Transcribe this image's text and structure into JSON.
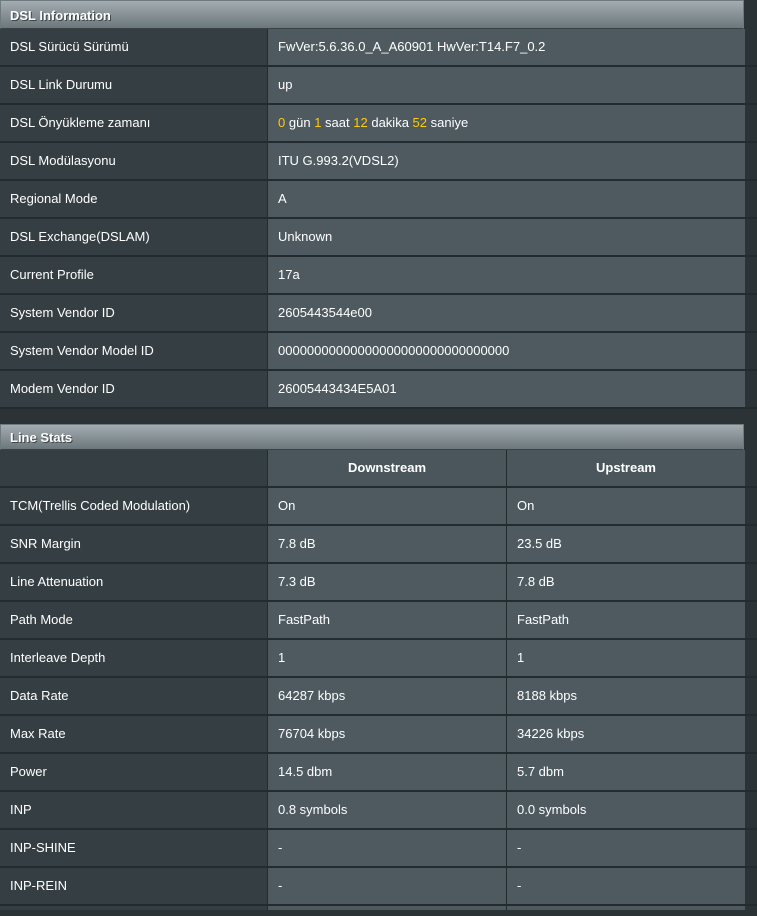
{
  "dsl_info": {
    "title": "DSL Information",
    "rows": [
      {
        "label": "DSL Sürücü Sürümü",
        "value": "FwVer:5.6.36.0_A_A60901 HwVer:T14.F7_0.2"
      },
      {
        "label": "DSL Link Durumu",
        "value": "up"
      },
      {
        "label": "DSL Modülasyonu",
        "value": "ITU G.993.2(VDSL2)"
      },
      {
        "label": "Regional Mode",
        "value": "A"
      },
      {
        "label": "DSL Exchange(DSLAM)",
        "value": "Unknown"
      },
      {
        "label": "Current Profile",
        "value": "17a"
      },
      {
        "label": "System Vendor ID",
        "value": "2605443544e00"
      },
      {
        "label": "System Vendor Model ID",
        "value": "00000000000000000000000000000000"
      },
      {
        "label": "Modem Vendor ID",
        "value": "26005443434E5A01"
      }
    ],
    "uptime": {
      "label": "DSL Önyükleme zamanı",
      "days": "0",
      "days_unit": "gün",
      "hours": "1",
      "hours_unit": "saat",
      "minutes": "12",
      "minutes_unit": "dakika",
      "seconds": "52",
      "seconds_unit": "saniye",
      "highlight_color": "#ffcc00"
    }
  },
  "line_stats": {
    "title": "Line Stats",
    "col_downstream": "Downstream",
    "col_upstream": "Upstream",
    "rows": [
      {
        "label": "TCM(Trellis Coded Modulation)",
        "down": "On",
        "up": "On"
      },
      {
        "label": "SNR Margin",
        "down": "7.8 dB",
        "up": "23.5 dB"
      },
      {
        "label": "Line Attenuation",
        "down": "7.3 dB",
        "up": "7.8 dB"
      },
      {
        "label": "Path Mode",
        "down": "FastPath",
        "up": "FastPath"
      },
      {
        "label": "Interleave Depth",
        "down": "1",
        "up": "1"
      },
      {
        "label": "Data Rate",
        "down": "64287 kbps",
        "up": "8188 kbps"
      },
      {
        "label": "Max Rate",
        "down": "76704 kbps",
        "up": "34226 kbps"
      },
      {
        "label": "Power",
        "down": "14.5 dbm",
        "up": "5.7 dbm"
      },
      {
        "label": "INP",
        "down": "0.8 symbols",
        "up": "0.0 symbols"
      },
      {
        "label": "INP-SHINE",
        "down": "-",
        "up": "-"
      },
      {
        "label": "INP-REIN",
        "down": "-",
        "up": "-"
      }
    ]
  }
}
